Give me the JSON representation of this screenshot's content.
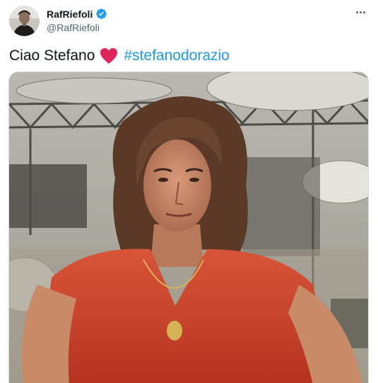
{
  "author": {
    "display_name": "RafRiefoli",
    "handle": "@RafRiefoli",
    "verified": true
  },
  "tweet": {
    "text_before": "Ciao Stefano",
    "emoji": "red-heart",
    "hashtag": "#stefanodorazio"
  },
  "colors": {
    "link": "#1d9bf0",
    "verified_badge": "#1d9bf0",
    "heart": "#e0245e"
  },
  "icons": {
    "more": "more-horizontal-icon",
    "verified": "verified-badge-icon"
  }
}
